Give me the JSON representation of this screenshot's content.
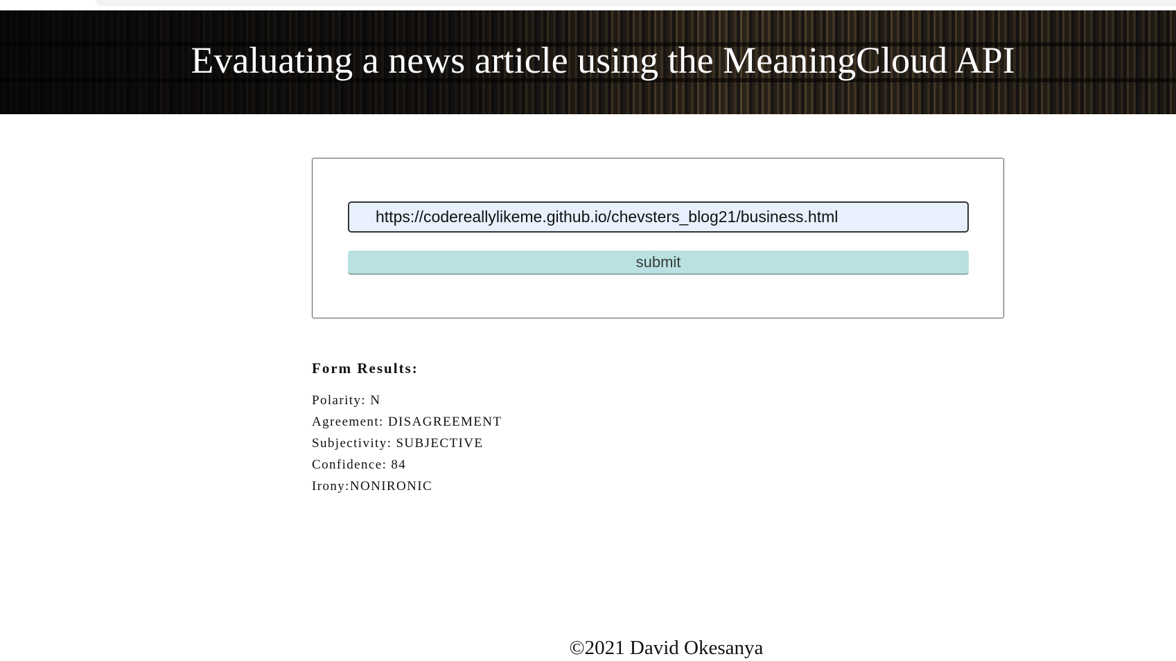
{
  "header": {
    "title": "Evaluating a news article using the MeaningCloud API"
  },
  "form": {
    "url_value": "https://codereallylikeme.github.io/chevsters_blog21/business.html",
    "submit_label": "submit"
  },
  "results": {
    "heading": "Form Results:",
    "lines": [
      "Polarity: N",
      "Agreement: DISAGREEMENT",
      "Subjectivity: SUBJECTIVE",
      "Confidence: 84",
      "Irony:NONIRONIC"
    ]
  },
  "footer": {
    "copyright": "©2021 David Okesanya"
  },
  "colors": {
    "input_background": "#e8f0fe",
    "button_background": "#b9e1e1",
    "header_text": "#ffffff"
  }
}
